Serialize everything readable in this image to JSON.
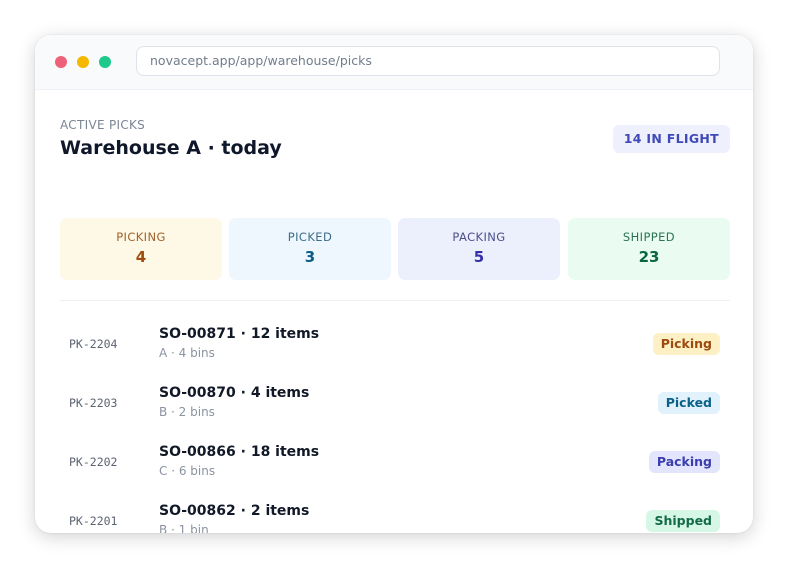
{
  "browser": {
    "url": "novacept.app/app/warehouse/picks"
  },
  "header": {
    "eyebrow": "ACTIVE PICKS",
    "title": "Warehouse A · today",
    "flight_badge": "14 IN FLIGHT"
  },
  "stats": [
    {
      "label": "PICKING",
      "value": "4"
    },
    {
      "label": "PICKED",
      "value": "3"
    },
    {
      "label": "PACKING",
      "value": "5"
    },
    {
      "label": "SHIPPED",
      "value": "23"
    }
  ],
  "picks": [
    {
      "id": "PK-2204",
      "order": "SO-00871 · 12 items",
      "detail": "A · 4 bins",
      "status": "Picking"
    },
    {
      "id": "PK-2203",
      "order": "SO-00870 · 4 items",
      "detail": "B · 2 bins",
      "status": "Picked"
    },
    {
      "id": "PK-2202",
      "order": "SO-00866 · 18 items",
      "detail": "C · 6 bins",
      "status": "Packing"
    },
    {
      "id": "PK-2201",
      "order": "SO-00862 · 2 items",
      "detail": "B · 1 bin",
      "status": "Shipped"
    }
  ],
  "colors": {
    "picking": "#fdf0c4",
    "picked": "#e1f2fd",
    "packing": "#e2e5fb",
    "shipped": "#d7f7e6",
    "accent": "#3f49b8"
  }
}
